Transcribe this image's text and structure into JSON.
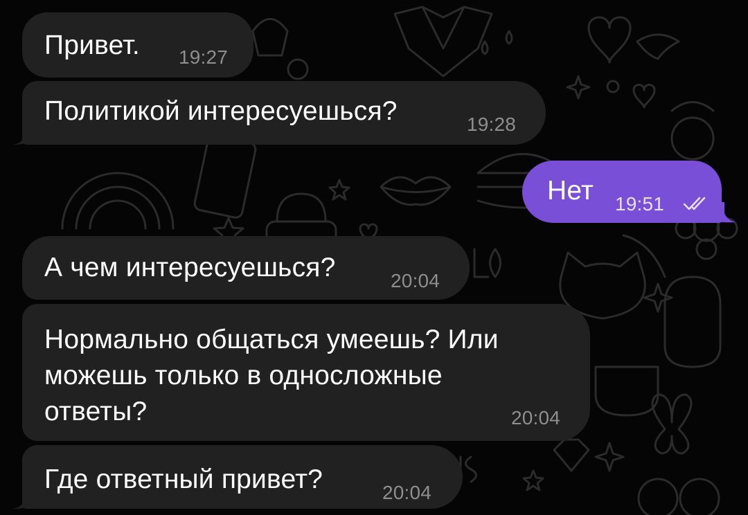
{
  "theme": {
    "background": "#050505",
    "incoming_bubble": "#212121",
    "outgoing_bubble": "#7a4fd8",
    "text": "#ffffff",
    "incoming_time": "#8e8e8e",
    "outgoing_time": "#e8defc",
    "doodle_stroke": "#2b2b2b"
  },
  "messages": [
    {
      "direction": "incoming",
      "text": "Привет.",
      "time": "19:27"
    },
    {
      "direction": "incoming",
      "text": "Политикой интересуешься?",
      "time": "19:28"
    },
    {
      "direction": "outgoing",
      "text": "Нет",
      "time": "19:51",
      "status_icon": "double-check-icon"
    },
    {
      "direction": "incoming",
      "text": "А чем интересуешься?",
      "time": "20:04"
    },
    {
      "direction": "incoming",
      "text": "Нормально общаться умеешь? Или\nможешь только в односложные\nответы?",
      "time": "20:04"
    },
    {
      "direction": "incoming",
      "text": "Где ответный привет?",
      "time": "20:04"
    }
  ]
}
